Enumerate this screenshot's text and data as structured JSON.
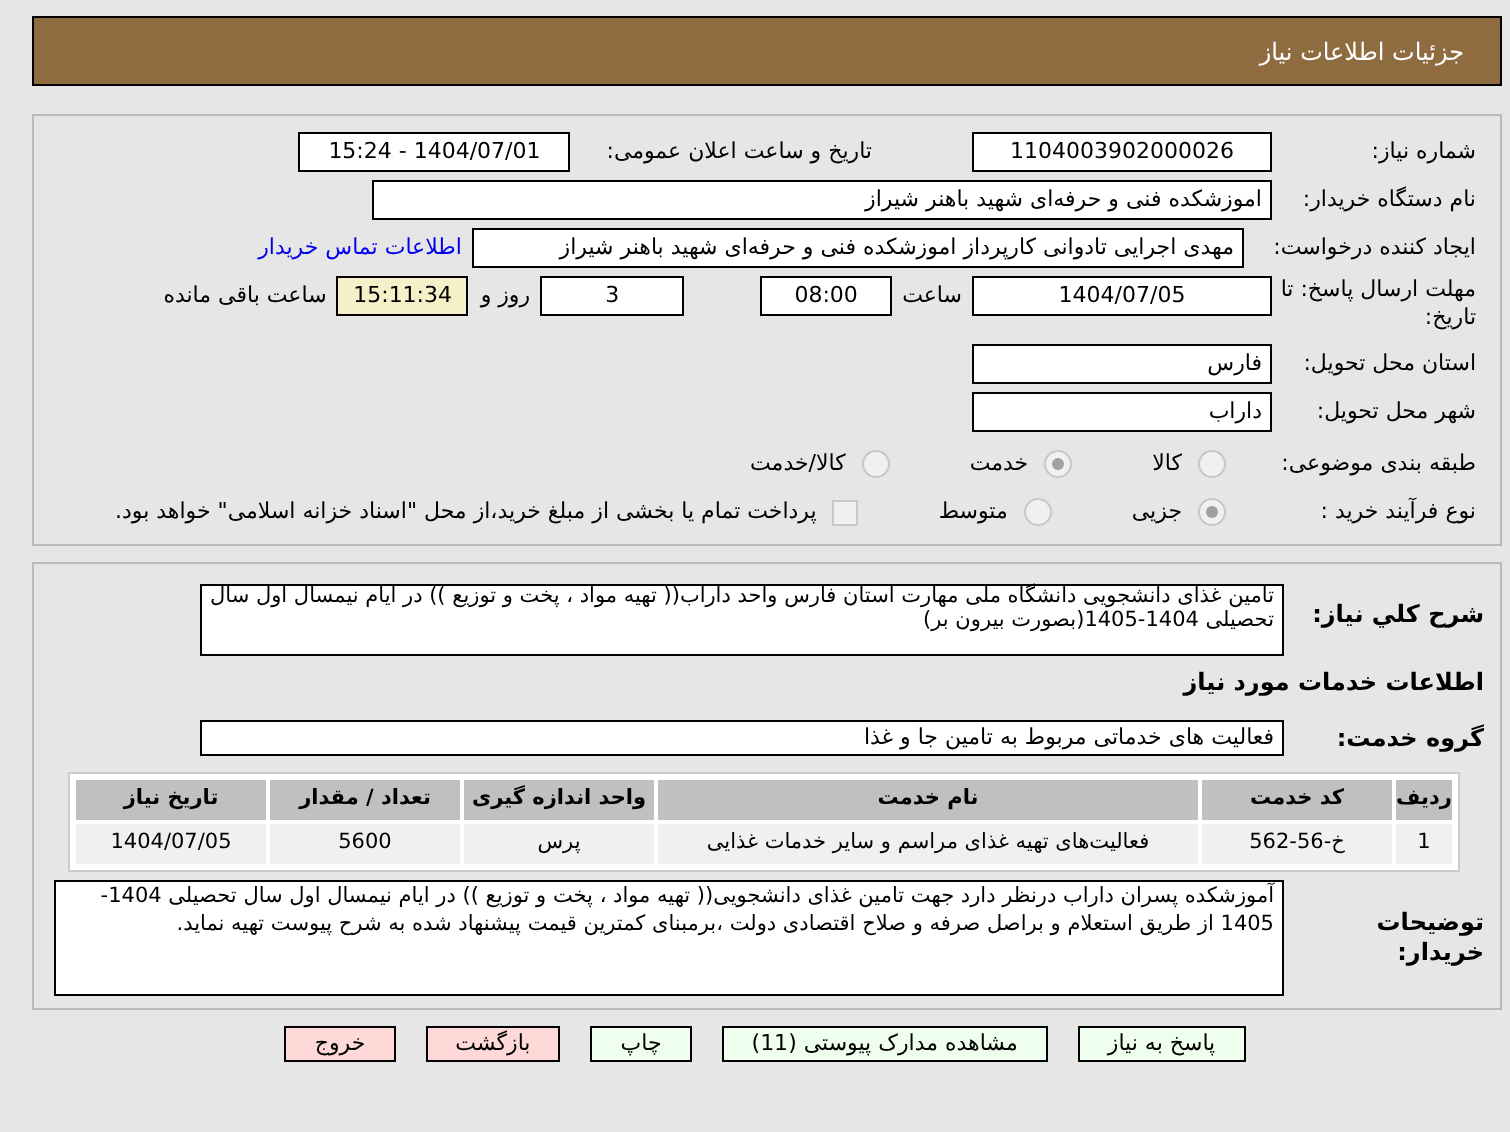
{
  "header": {
    "title": "جزئیات اطلاعات نیاز"
  },
  "need_number": {
    "label": "شماره نیاز:",
    "value": "1104003902000026"
  },
  "announce_date": {
    "label": "تاریخ و ساعت اعلان عمومی:",
    "value": "1404/07/01 - 15:24"
  },
  "buyer_org": {
    "label": "نام دستگاه خریدار:",
    "value": "اموزشکده فنی و حرفه‌ای شهید باهنر شیراز"
  },
  "requester": {
    "label": "ایجاد کننده درخواست:",
    "value": "مهدی اجرایی تادوانی کارپرداز اموزشکده فنی و حرفه‌ای شهید باهنر شیراز",
    "link": "اطلاعات تماس خریدار"
  },
  "deadline": {
    "label": "مهلت ارسال پاسخ: تا تاریخ:",
    "date": "1404/07/05",
    "time_label": "ساعت",
    "time": "08:00",
    "days": "3",
    "days_label": "روز و",
    "remaining": "15:11:34",
    "remaining_label": "ساعت باقی مانده"
  },
  "province": {
    "label": "استان محل تحویل:",
    "value": "فارس"
  },
  "city": {
    "label": "شهر محل تحویل:",
    "value": "داراب"
  },
  "category": {
    "label": "طبقه بندی موضوعی:",
    "options": [
      {
        "label": "کالا",
        "selected": false
      },
      {
        "label": "خدمت",
        "selected": true
      },
      {
        "label": "کالا/خدمت",
        "selected": false
      }
    ]
  },
  "process": {
    "label": "نوع فرآیند خرید :",
    "options": [
      {
        "label": "جزیی",
        "selected": true
      },
      {
        "label": "متوسط",
        "selected": false
      }
    ],
    "payment_note": {
      "checked": false,
      "label": "پرداخت تمام یا بخشی از مبلغ خرید،از محل \"اسناد خزانه اسلامی\" خواهد بود."
    }
  },
  "summary": {
    "label": "شرح کلي نياز:",
    "value": "تامین غذای دانشجویی دانشگاه ملی مهارت استان فارس واحد داراب(( تهیه مواد ، پخت و توزیع )) در ایام نیمسال اول سال تحصیلی 1404-1405(بصورت بیرون بر)"
  },
  "services_heading": "اطلاعات خدمات مورد نیاز",
  "service_group": {
    "label": "گروه خدمت:",
    "value": "فعالیت های خدماتی مربوط به تامین جا و غذا"
  },
  "table": {
    "columns": [
      "ردیف",
      "کد خدمت",
      "نام خدمت",
      "واحد اندازه گیری",
      "تعداد / مقدار",
      "تاریخ نیاز"
    ],
    "rows": [
      [
        "1",
        "خ-56-562",
        "فعالیت‌های تهیه غذای مراسم و سایر خدمات غذایی",
        "پرس",
        "5600",
        "1404/07/05"
      ]
    ]
  },
  "buyer_notes": {
    "label": "توضیحات خریدار:",
    "value": "آموزشکده پسران  داراب درنظر دارد جهت تامین غذای دانشجویی(( تهیه مواد ، پخت و توزیع )) در ایام  نیمسال اول سال تحصیلی 1404-1405 از طریق استعلام و براصل صرفه و صلاح اقتصادی دولت ،برمبنای کمترین قیمت پیشنهاد شده به شرح پیوست تهیه نماید."
  },
  "buttons": [
    {
      "label": "پاسخ به نیاز",
      "kind": "normal"
    },
    {
      "label": "مشاهده مدارک پیوستی (11)",
      "kind": "normal"
    },
    {
      "label": "چاپ",
      "kind": "normal"
    },
    {
      "label": "بازگشت",
      "kind": "danger"
    },
    {
      "label": "خروج",
      "kind": "danger"
    }
  ]
}
